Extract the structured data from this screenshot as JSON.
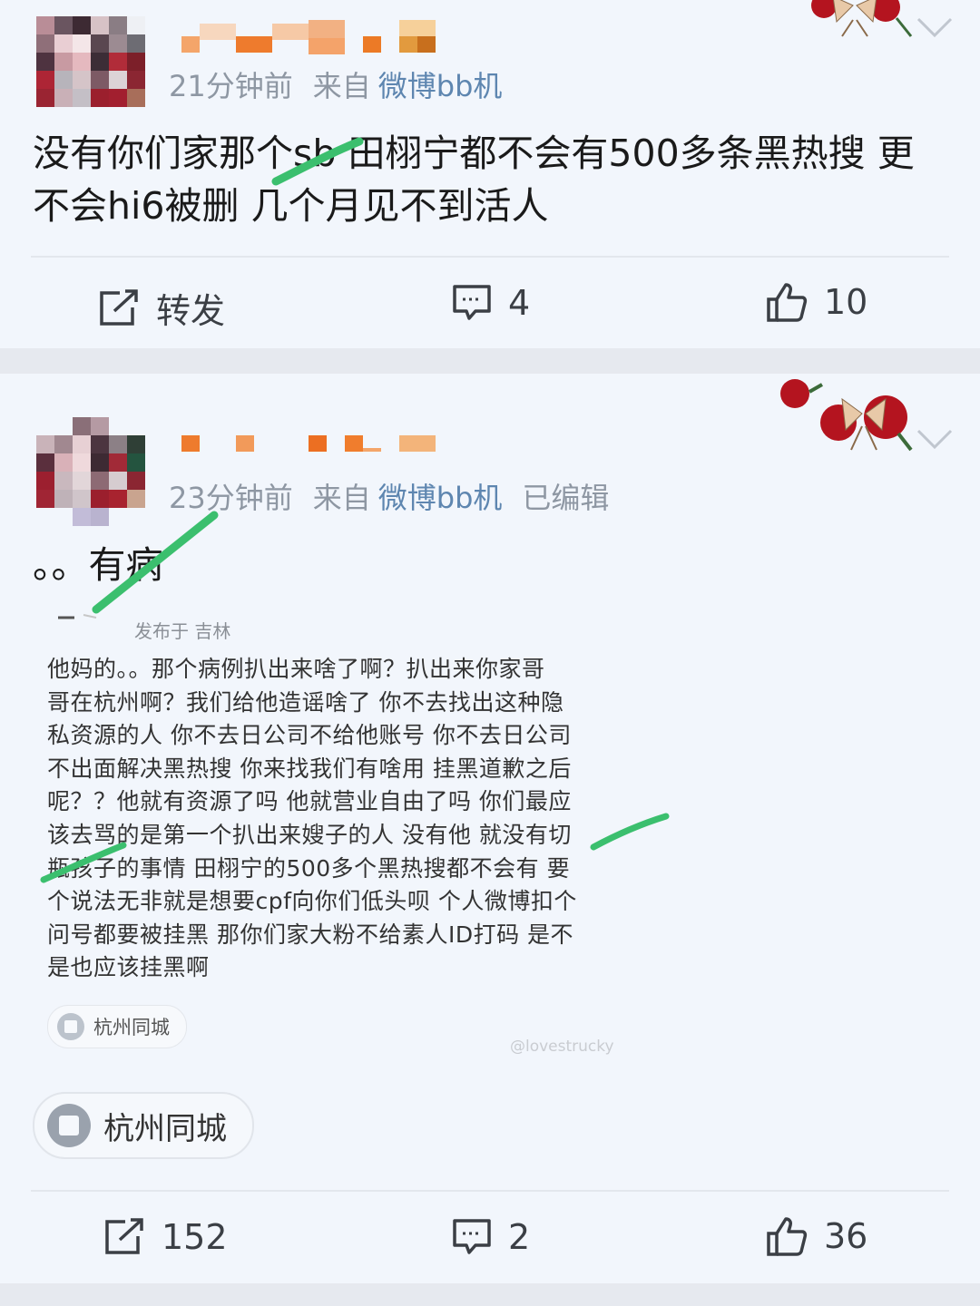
{
  "colors": {
    "link": "#5e86b0",
    "meta": "#8e97a3",
    "strike": "#3bbf6e",
    "background": "#f2f6fc"
  },
  "posts": [
    {
      "time": "21分钟前",
      "from_label": "来自",
      "source": "微博bb机",
      "text_line1": "没有你们家那个sb 田栩宁都不会有500多条黑热搜 更",
      "text_line2": "不会hi6被删 几个月见不到活人",
      "actions": {
        "repost": "转发",
        "comments": "4",
        "likes": "10"
      }
    },
    {
      "time": "23分钟前",
      "from_label": "来自",
      "source": "微博bb机",
      "edited": "已编辑",
      "text": "。。有病",
      "embed": {
        "meta": "发布于 吉林",
        "lines": [
          "他妈的。。那个病例扒出来啥了啊？扒出来你家哥",
          "哥在杭州啊？我们给他造谣啥了 你不去找出这种隐",
          "私资源的人 你不去日公司不给他账号 你不去日公司",
          "不出面解决黑热搜 你来找我们有啥用 挂黑道歉之后",
          "呢？？他就有资源了吗 他就营业自由了吗 你们最应",
          "该去骂的是第一个扒出来嫂子的人 没有他 就没有切",
          "瓶孩子的事情 田栩宁的500多个黑热搜都不会有 要",
          "个说法无非就是想要cpf向你们低头呗 个人微博扣个",
          "问号都要被挂黑 那你们家大粉不给素人ID打码 是不",
          "是也应该挂黑啊"
        ],
        "location": "杭州同城",
        "watermark": "@lovestrucky"
      },
      "location": "杭州同城",
      "actions": {
        "repost": "152",
        "comments": "2",
        "likes": "36"
      }
    }
  ]
}
